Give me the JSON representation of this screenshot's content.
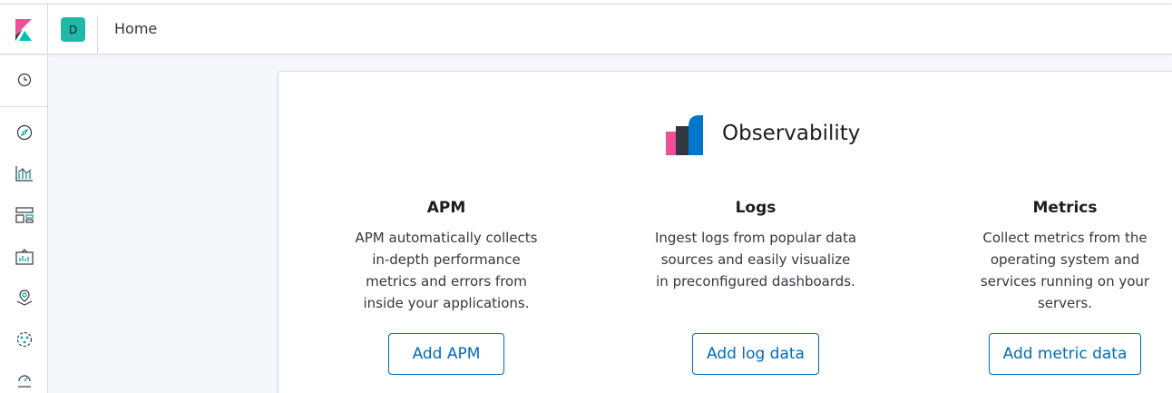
{
  "header": {
    "space_initial": "D",
    "breadcrumb": "Home"
  },
  "sidebar": {
    "items": [
      {
        "icon": "clock-icon"
      },
      {
        "icon": "compass-icon"
      },
      {
        "icon": "visualize-icon"
      },
      {
        "icon": "dashboard-icon"
      },
      {
        "icon": "canvas-icon"
      },
      {
        "icon": "maps-icon"
      },
      {
        "icon": "ml-icon"
      },
      {
        "icon": "metrics-app-icon"
      }
    ]
  },
  "observability": {
    "title": "Observability",
    "columns": [
      {
        "title": "APM",
        "desc": [
          "APM automatically collects",
          "in-depth performance",
          "metrics and errors from",
          "inside your applications."
        ],
        "button": "Add APM"
      },
      {
        "title": "Logs",
        "desc": [
          "Ingest logs from popular data",
          "sources and easily visualize",
          "in preconfigured dashboards."
        ],
        "button": "Add log data"
      },
      {
        "title": "Metrics",
        "desc": [
          "Collect metrics from the",
          "operating system and",
          "services running on your",
          "servers."
        ],
        "button": "Add metric data"
      }
    ]
  },
  "colors": {
    "accent": "#006bb8",
    "space": "#20b8a6",
    "logo_pink": "#f04e98",
    "logo_dark": "#343741",
    "logo_blue": "#0077cc"
  }
}
